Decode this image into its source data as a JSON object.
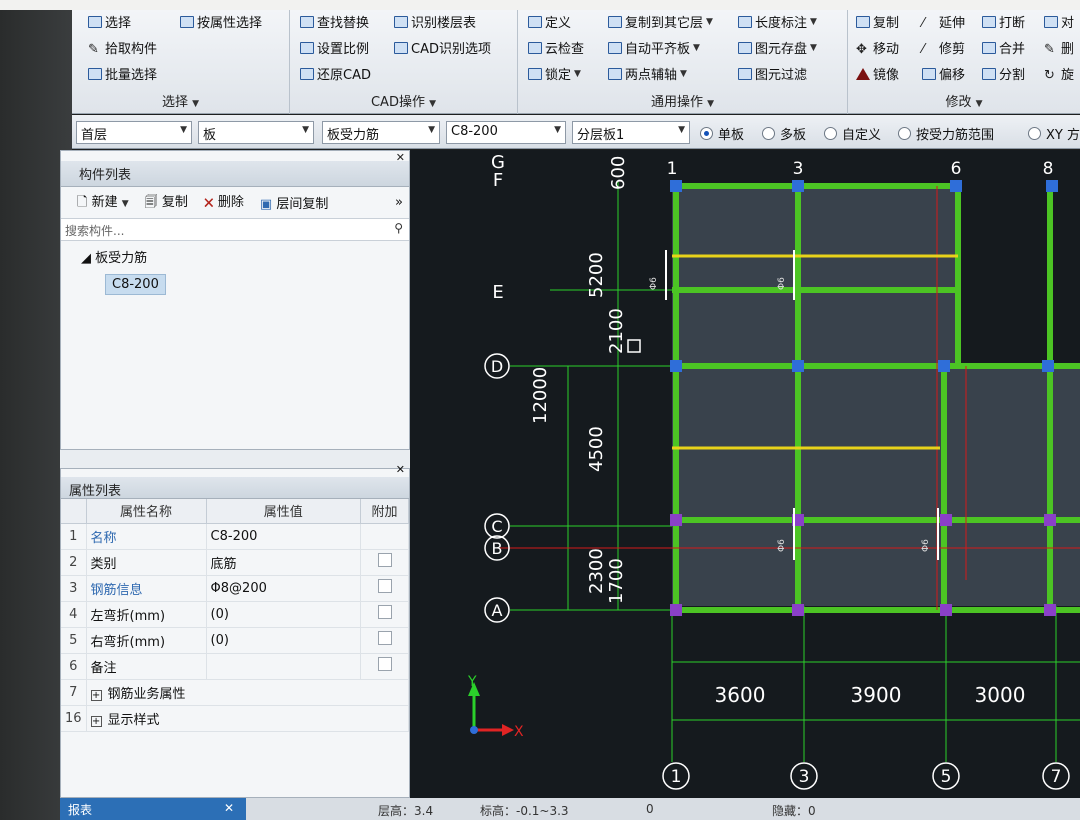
{
  "ribbon": {
    "select_group": {
      "label": "选择",
      "select": "选择",
      "pick": "拾取构件",
      "batch": "批量选择",
      "by_attr": "按属性选择"
    },
    "cad_group": {
      "label": "CAD操作",
      "find_replace": "查找替换",
      "set_scale": "设置比例",
      "restore_cad": "还原CAD",
      "identify_floors": "识别楼层表",
      "cad_options": "CAD识别选项"
    },
    "general_group": {
      "label": "通用操作",
      "define": "定义",
      "cloud_check": "云检查",
      "lock": "锁定",
      "copy_to_other": "复制到其它层",
      "auto_align": "自动平齐板",
      "two_point_axis": "两点辅轴",
      "length_dim": "长度标注",
      "save_element": "图元存盘",
      "element_filter": "图元过滤"
    },
    "modify_group": {
      "label": "修改",
      "copy": "复制",
      "move": "移动",
      "mirror": "镜像",
      "extend": "延伸",
      "trim": "修剪",
      "offset": "偏移",
      "break": "打断",
      "merge": "合并",
      "split": "分割",
      "rotate": "旋",
      "delete": "删",
      "align": "对"
    }
  },
  "combo_bar": {
    "floor": "首层",
    "type": "板",
    "subtype": "板受力筋",
    "spec": "C8-200",
    "layer": "分层板1",
    "radios": [
      "单板",
      "多板",
      "自定义",
      "按受力筋范围",
      "XY 方"
    ]
  },
  "component_list": {
    "title": "构件列表",
    "new": "新建",
    "copy": "复制",
    "delete": "删除",
    "floor_copy": "层间复制",
    "search_placeholder": "搜索构件...",
    "root": "板受力筋",
    "item": "C8-200"
  },
  "property_list": {
    "title": "属性列表",
    "col_name": "属性名称",
    "col_value": "属性值",
    "col_extra": "附加",
    "rows": [
      {
        "n": "1",
        "name": "名称",
        "value": "C8-200"
      },
      {
        "n": "2",
        "name": "类别",
        "value": "底筋"
      },
      {
        "n": "3",
        "name": "钢筋信息",
        "value": "Φ8@200"
      },
      {
        "n": "4",
        "name": "左弯折(mm)",
        "value": "(0)"
      },
      {
        "n": "5",
        "name": "右弯折(mm)",
        "value": "(0)"
      },
      {
        "n": "6",
        "name": "备注",
        "value": ""
      },
      {
        "n": "7",
        "name": "钢筋业务属性",
        "value": ""
      },
      {
        "n": "16",
        "name": "显示样式",
        "value": ""
      }
    ]
  },
  "drawing": {
    "row_axes": [
      "G",
      "F",
      "E",
      "D",
      "C",
      "B",
      "A"
    ],
    "col_axes_top": [
      "1",
      "3",
      "6",
      "8"
    ],
    "col_axes_bottom": [
      "1",
      "3",
      "5",
      "7"
    ],
    "vertical_dims": [
      "600",
      "5200",
      "2100",
      "12000",
      "4500",
      "2300",
      "1700"
    ],
    "horizontal_dims": [
      "3600",
      "3900",
      "3000"
    ],
    "rebar_marks": [
      "Φ6",
      "Φ6",
      "Φ6",
      "Φ6"
    ],
    "ucs_x": "X",
    "ucs_y": "Y"
  },
  "status": {
    "report": "报表",
    "floor_height": "层高：3.4",
    "elevation": "标高：-0.1~3.3",
    "count": "0",
    "hidden": "隐藏：0"
  },
  "colors": {
    "accent": "#1452b8",
    "canvas_bg": "#151a1e",
    "beam_green": "#4cc424",
    "rebar_yellow": "#e8d21a",
    "axis_red": "#d21a1a"
  }
}
